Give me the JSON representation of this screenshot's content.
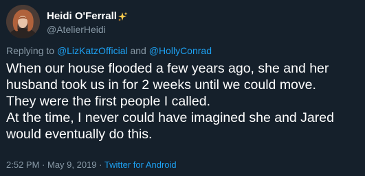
{
  "author": {
    "display_name": "Heidi O'Ferrall",
    "handle": "@AtelierHeidi",
    "badge_icon": "sparkles-icon"
  },
  "reply": {
    "prefix": "Replying to ",
    "mention1": "@LizKatzOfficial",
    "joiner": " and ",
    "mention2": "@HollyConrad"
  },
  "tweet": {
    "lines": [
      "When our house flooded a few years ago, she and her",
      "husband took us in for 2 weeks until we could move.",
      "They were the first people I called.",
      "At the time, I never could have imagined she and Jared",
      "would eventually do this."
    ]
  },
  "meta": {
    "time": "2:52 PM",
    "sep1": " · ",
    "date": "May 9, 2019",
    "sep2": " · ",
    "source": "Twitter for Android"
  },
  "colors": {
    "background": "#15202b",
    "secondary_text": "#8899a6",
    "link": "#1da1f2"
  }
}
